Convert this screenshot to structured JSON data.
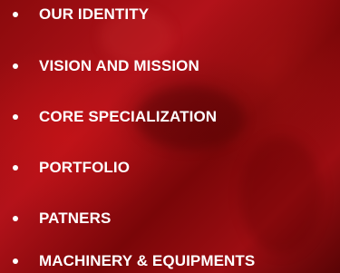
{
  "menu": {
    "items": [
      {
        "label": "OUR IDENTITY"
      },
      {
        "label": "VISION AND MISSION"
      },
      {
        "label": "CORE SPECIALIZATION"
      },
      {
        "label": "PORTFOLIO"
      },
      {
        "label": "PATNERS"
      },
      {
        "label": "MACHINERY & EQUIPMENTS"
      }
    ]
  },
  "colors": {
    "text": "#ffffff",
    "bullet": "#ffffff",
    "background": "#9c0d12"
  }
}
